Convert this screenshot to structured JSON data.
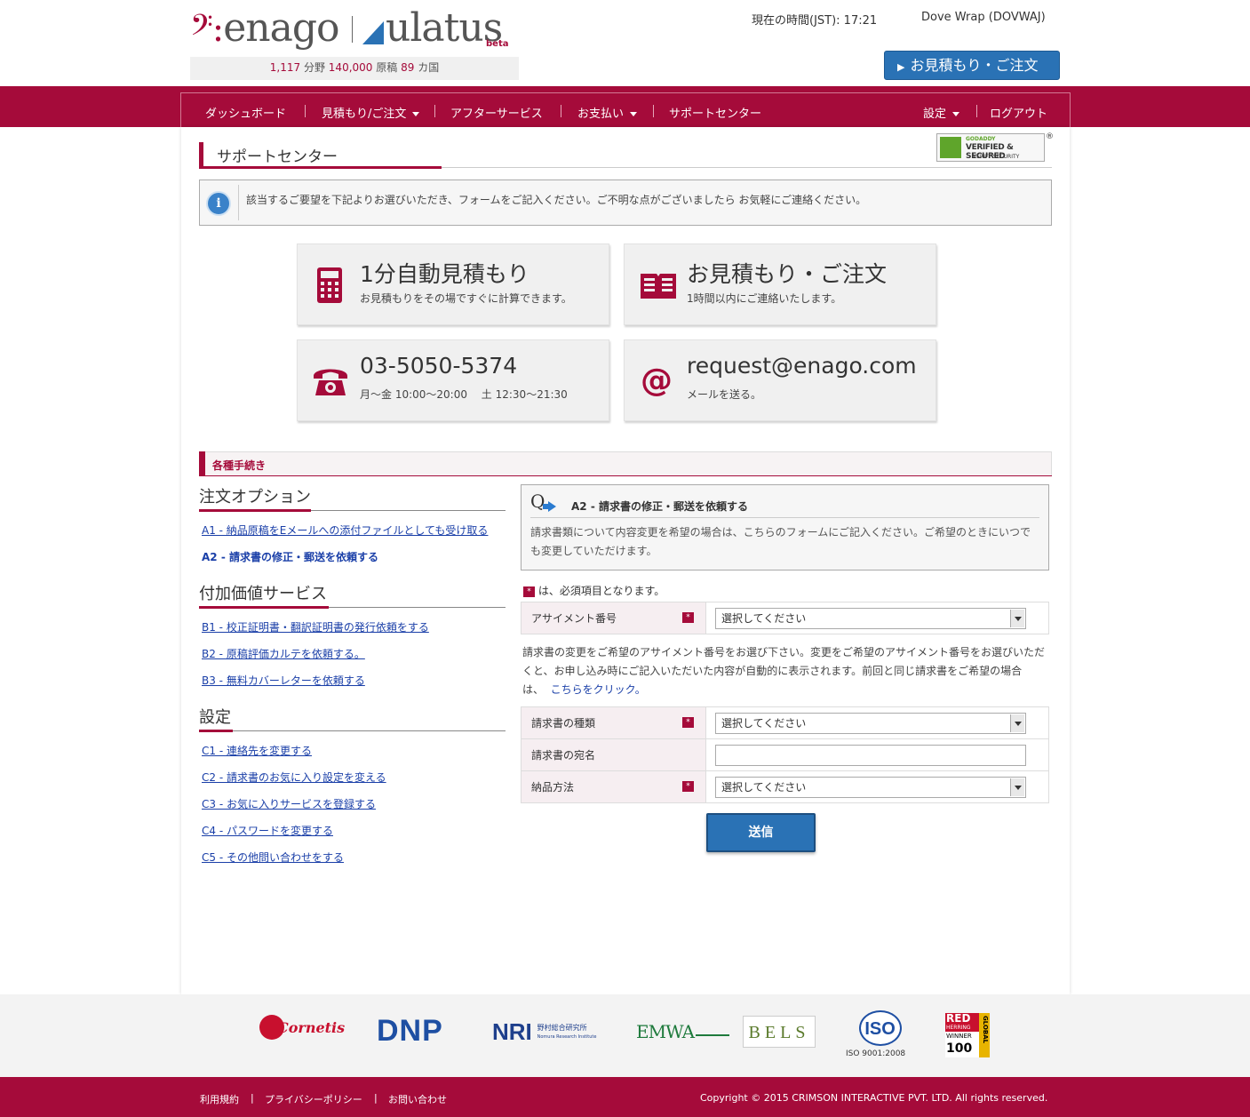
{
  "header": {
    "logo_enago_dot": "𝄢:",
    "logo_enago": "enago",
    "logo_ulatus": "ulatus",
    "logo_beta": "beta",
    "stats_a": "1,117",
    "stats_a_unit": "分野",
    "stats_b": "140,000",
    "stats_b_unit": "原稿",
    "stats_c": "89",
    "stats_c_unit": "カ国",
    "time_label": "現在の時間(JST): 17:21",
    "user": "Dove Wrap (DOVWAJ)",
    "quote_button": "お見積もり・ご注文"
  },
  "nav": {
    "items": [
      {
        "label": "ダッシュボード"
      },
      {
        "label": "見積もり/ご注文"
      },
      {
        "label": "アフターサービス"
      },
      {
        "label": "お支払い"
      },
      {
        "label": "サポートセンター"
      },
      {
        "label": "設定"
      },
      {
        "label": "ログアウト"
      }
    ]
  },
  "page": {
    "title": "サポートセンター",
    "godaddy": {
      "line1": "GODADDY",
      "line2": "VERIFIED & SECURED",
      "line3": "VERIFY SECURITY",
      "reg": "®"
    },
    "info_text": "該当するご要望を下記よりお選びいただき、フォームをご記入ください。ご不明な点がございましたら お気軽にご連絡ください。"
  },
  "cards": [
    {
      "icon": "calculator-icon",
      "title": "1分自動見積もり",
      "sub": "お見積もりをその場ですぐに計算できます。"
    },
    {
      "icon": "book-icon",
      "title": "お見積もり・ご注文",
      "sub": "1時間以内にご連絡いたします。"
    },
    {
      "icon": "phone-icon",
      "title": "03-5050-5374",
      "sub": "月～金 10:00～20:00　 土 12:30～21:30"
    },
    {
      "icon": "at-icon",
      "title": "request@enago.com",
      "sub": "メールを送る。"
    }
  ],
  "procedures": {
    "header": "各種手続き",
    "groups": [
      {
        "title": "注文オプション",
        "links": [
          {
            "label": "A1 - 納品原稿をEメールへの添付ファイルとしても受け取る"
          },
          {
            "label": "A2 - 請求書の修正・郵送を依頼する"
          }
        ]
      },
      {
        "title": "付加価値サービス",
        "links": [
          {
            "label": "B1 - 校正証明書・翻訳証明書の発行依頼をする"
          },
          {
            "label": "B2 - 原稿評価カルテを依頼する。"
          },
          {
            "label": "B3 - 無料カバーレターを依頼する"
          }
        ]
      },
      {
        "title": "設定",
        "links": [
          {
            "label": "C1 - 連絡先を変更する"
          },
          {
            "label": "C2 - 請求書のお気に入り設定を変える"
          },
          {
            "label": "C3 - お気に入りサービスを登録する"
          },
          {
            "label": "C4 - パスワードを変更する"
          },
          {
            "label": "C5 - その他問い合わせをする"
          }
        ]
      }
    ]
  },
  "question": {
    "q": "Q",
    "title": "A2 - 請求書の修正・郵送を依頼する",
    "body": "請求書類について内容変更を希望の場合は、こちらのフォームにご記入ください。ご希望のときにいつでも変更していただけます。"
  },
  "form": {
    "required_mark": "*",
    "required_note": "は、必須項目となります。",
    "assignment_label": "アサイメント番号",
    "assignment_value": "選択してください",
    "desc_text": "請求書の変更をご希望のアサイメント番号をお選び下さい。変更をご希望のアサイメント番号をお選びいただくと、お申し込み時にご記入いただいた内容が自動的に表示されます。前回と同じ請求書をご希望の場合は、",
    "desc_link": "こちらをクリック。",
    "invoice_type_label": "請求書の種類",
    "invoice_type_value": "選択してください",
    "invoice_to_label": "請求書の宛名",
    "invoice_to_value": "",
    "delivery_label": "納品方法",
    "delivery_value": "選択してください",
    "submit": "送信"
  },
  "partners": {
    "cornetis": "Cornetis",
    "dnp": "DNP",
    "nri": "NRI",
    "nri_jp": "野村総合研究所",
    "nri_en": "Nomura Research Institute",
    "emwa": "EMWA",
    "bels": "BELS",
    "iso": "ISO",
    "iso_caption": "ISO 9001:2008",
    "red": "RED",
    "herring": "HERRING",
    "winner": "WINNER",
    "hundred": "100",
    "global": "GLOBAL"
  },
  "footer": {
    "links": [
      {
        "label": "利用規約"
      },
      {
        "label": "プライバシーポリシー"
      },
      {
        "label": "お問い合わせ"
      }
    ],
    "sep": "|",
    "copyright": "Copyright © 2015 CRIMSON INTERACTIVE PVT. LTD. All rights reserved."
  },
  "colors": {
    "brand": "#a50b3a",
    "button": "#2a72b5"
  }
}
